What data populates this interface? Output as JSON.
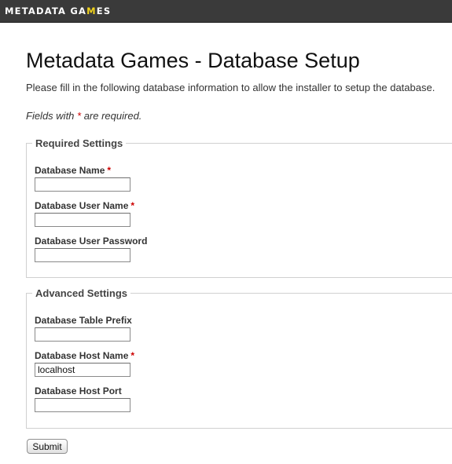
{
  "header": {
    "logo_part1": "METADATA GA",
    "logo_accent": "M",
    "logo_part2": "ES"
  },
  "page": {
    "title": "Metadata Games - Database Setup",
    "intro": "Please fill in the following database information to allow the installer to setup the database.",
    "note_prefix": "Fields with ",
    "note_asterisk": "*",
    "note_suffix": " are required."
  },
  "required_settings": {
    "legend": "Required Settings",
    "fields": [
      {
        "label": "Database Name",
        "required": "*",
        "value": ""
      },
      {
        "label": "Database User Name",
        "required": "*",
        "value": ""
      },
      {
        "label": "Database User Password",
        "required": "",
        "value": ""
      }
    ]
  },
  "advanced_settings": {
    "legend": "Advanced Settings",
    "fields": [
      {
        "label": "Database Table Prefix",
        "required": "",
        "value": ""
      },
      {
        "label": "Database Host Name",
        "required": "*",
        "value": "localhost"
      },
      {
        "label": "Database Host Port",
        "required": "",
        "value": ""
      }
    ]
  },
  "form": {
    "submit_label": "Submit"
  },
  "colors": {
    "topbar": "#3a3a3a",
    "logo_accent": "#f0d21c",
    "required_marker": "#cc0000"
  }
}
